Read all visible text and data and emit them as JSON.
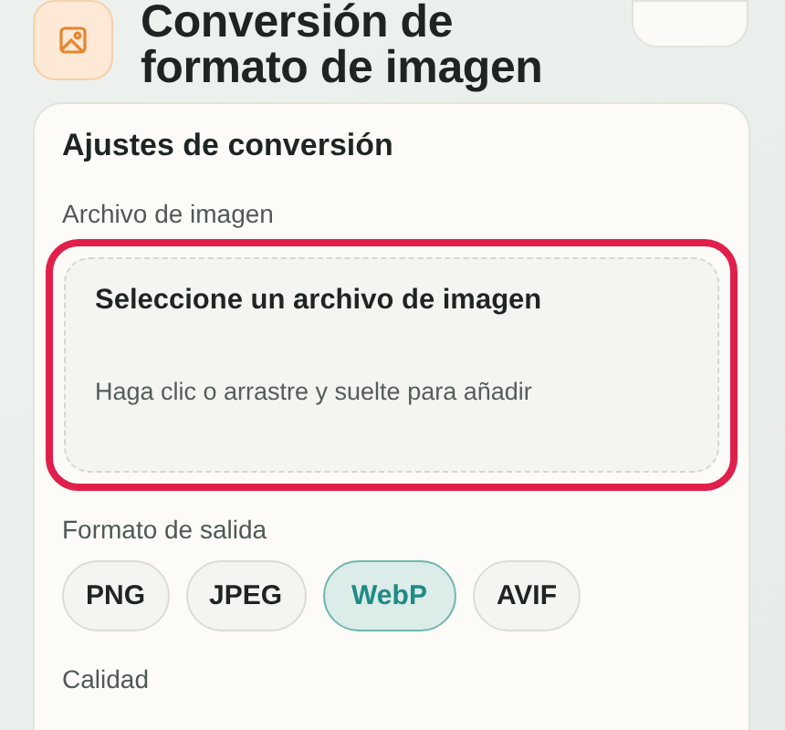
{
  "header": {
    "title": "Conversión de formato de imagen"
  },
  "settings": {
    "title": "Ajustes de conversión",
    "file_label": "Archivo de imagen",
    "dropzone": {
      "title": "Seleccione un archivo de imagen",
      "hint": "Haga clic o arrastre y suelte para añadir",
      "highlighted": true
    },
    "format_label": "Formato de salida",
    "formats": [
      {
        "label": "PNG",
        "selected": false
      },
      {
        "label": "JPEG",
        "selected": false
      },
      {
        "label": "WebP",
        "selected": true
      },
      {
        "label": "AVIF",
        "selected": false
      }
    ],
    "quality_label": "Calidad"
  }
}
